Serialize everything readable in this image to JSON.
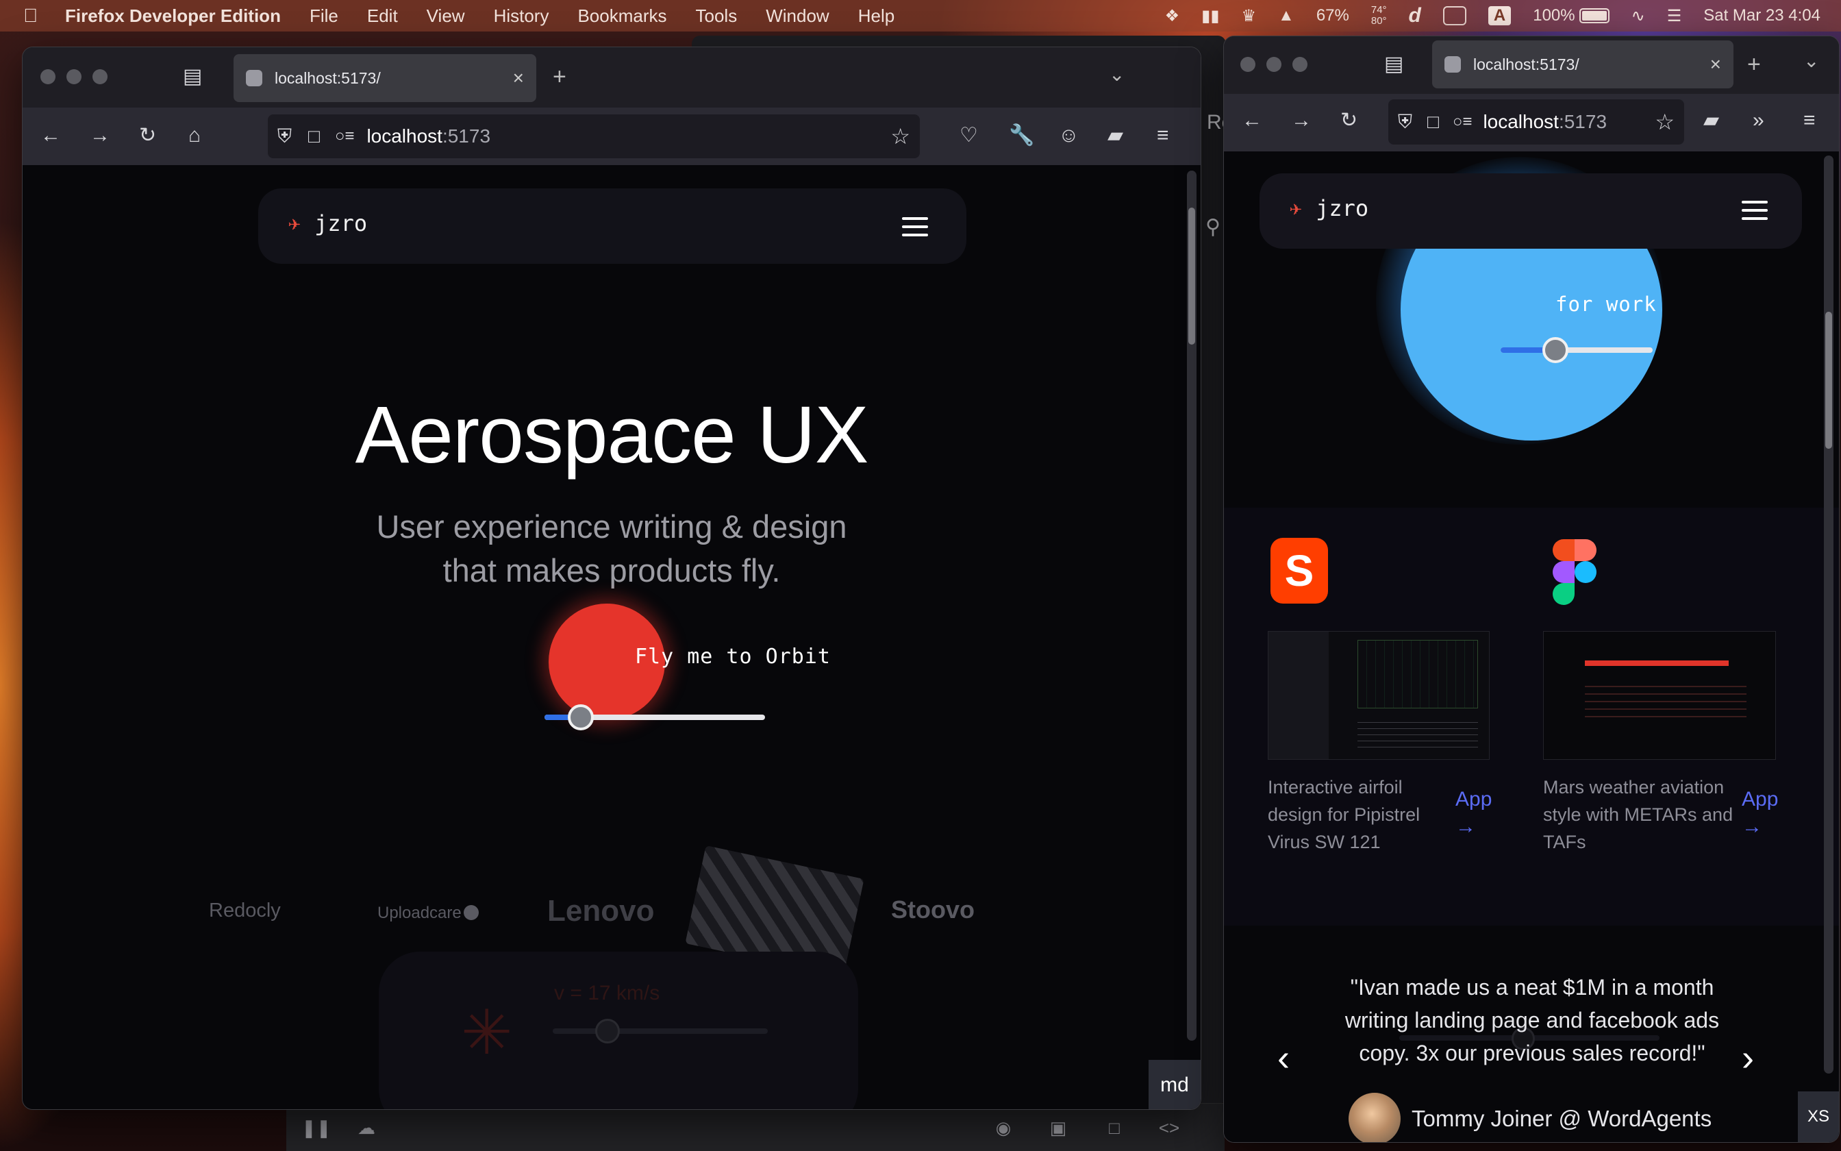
{
  "menubar": {
    "app_name": "Firefox Developer Edition",
    "items": [
      "File",
      "Edit",
      "View",
      "History",
      "Bookmarks",
      "Tools",
      "Window",
      "Help"
    ],
    "cpu": "67%",
    "temp_top": "74°",
    "temp_bottom": "80°",
    "input_source": "A",
    "battery": "100%",
    "datetime": "Sat Mar 23  4:04"
  },
  "left_window": {
    "tab_title": "localhost:5173/",
    "url_host": "localhost",
    "url_port": ":5173",
    "brand": "jzro",
    "hero_title": "Aerospace UX",
    "hero_sub_line1": "User experience writing & design",
    "hero_sub_line2": "that makes products fly.",
    "cta_label": "Fly me to Orbit",
    "cta_slider_value": 0.12,
    "logos": [
      "Redocly",
      "Uploadcare",
      "Lenovo",
      "Stoovo"
    ],
    "ghost_speed_label": "v = 17 km/s",
    "breakpoint_badge": "md",
    "scroll_position": 0.05
  },
  "right_window": {
    "tab_title": "localhost:5173/",
    "url_host": "localhost",
    "url_port": ":5173",
    "brand": "jzro",
    "orb_label": "for work",
    "orb_slider_value": 0.33,
    "projects": [
      {
        "tool_icon": "svelte-icon",
        "title_lines": [
          "Interactive airfoil",
          "design for Pipistrel",
          "Virus SW 121"
        ],
        "link_label": "App",
        "link_arrow": "→"
      },
      {
        "tool_icon": "figma-icon",
        "title_lines": [
          "Mars weather aviation",
          "style with METARs and",
          "TAFs"
        ],
        "link_label": "App",
        "link_arrow": "→"
      }
    ],
    "testimonial_lines": [
      "\"Ivan made us a neat $1M in a month",
      "writing landing page and facebook ads",
      "copy. 3x our previous sales record!\""
    ],
    "testimonial_author": "Tommy Joiner @ WordAgents",
    "breakpoint_badge": "XS",
    "scroll_position": 0.2
  },
  "colors": {
    "cta_orb": "#e5342b",
    "work_orb": "#4fb3f6",
    "slider_fill": "#2f6fe6",
    "app_link": "#5b6cf5"
  },
  "background_window_label": "Re"
}
